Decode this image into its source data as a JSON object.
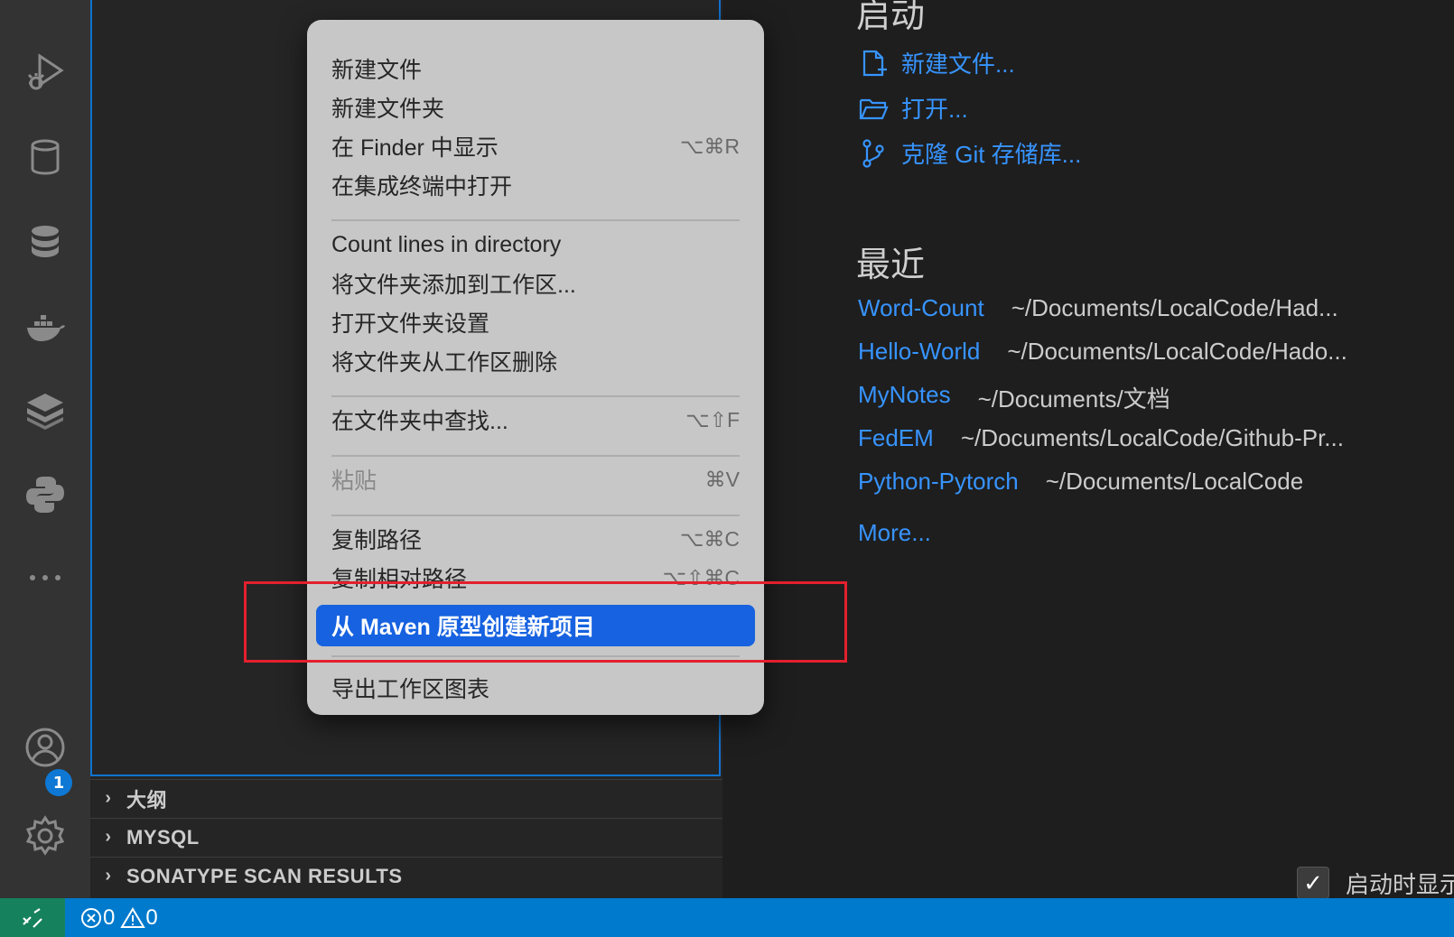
{
  "activity_bar": {
    "icons": [
      "run-debug-icon",
      "database-icon",
      "database-stack-icon",
      "docker-icon",
      "layers-icon",
      "python-icon",
      "more-icon",
      "account-icon",
      "settings-gear-icon"
    ],
    "account_badge": "1"
  },
  "sidebar": {
    "sections": [
      {
        "label": "大纲"
      },
      {
        "label": "MYSQL"
      },
      {
        "label": "SONATYPE SCAN RESULTS"
      }
    ]
  },
  "context_menu": {
    "items": [
      {
        "label": "新建文件",
        "shortcut": ""
      },
      {
        "label": "新建文件夹",
        "shortcut": ""
      },
      {
        "label": "在 Finder 中显示",
        "shortcut": "⌥⌘R"
      },
      {
        "label": "在集成终端中打开",
        "shortcut": ""
      },
      {
        "label": "Count lines in directory",
        "shortcut": ""
      },
      {
        "label": "将文件夹添加到工作区...",
        "shortcut": ""
      },
      {
        "label": "打开文件夹设置",
        "shortcut": ""
      },
      {
        "label": "将文件夹从工作区删除",
        "shortcut": ""
      },
      {
        "label": "在文件夹中查找...",
        "shortcut": "⌥⇧F"
      },
      {
        "label": "粘贴",
        "shortcut": "⌘V"
      },
      {
        "label": "复制路径",
        "shortcut": "⌥⌘C"
      },
      {
        "label": "复制相对路径",
        "shortcut": "⌥⇧⌘C"
      },
      {
        "label": "从 Maven 原型创建新项目",
        "shortcut": ""
      },
      {
        "label": "导出工作区图表",
        "shortcut": ""
      }
    ],
    "highlight_color": "#1662e0",
    "callout_color": "#e3202d"
  },
  "welcome": {
    "start_heading": "启动",
    "start_links": [
      {
        "label": "新建文件...",
        "icon": "new-file-icon"
      },
      {
        "label": "打开...",
        "icon": "folder-open-icon"
      },
      {
        "label": "克隆 Git 存储库...",
        "icon": "git-branch-icon"
      }
    ],
    "recent_heading": "最近",
    "recent": [
      {
        "name": "Word-Count",
        "path": "~/Documents/LocalCode/Had..."
      },
      {
        "name": "Hello-World",
        "path": "~/Documents/LocalCode/Hado..."
      },
      {
        "name": "MyNotes",
        "path": "~/Documents/文档"
      },
      {
        "name": "FedEM",
        "path": "~/Documents/LocalCode/Github-Pr..."
      },
      {
        "name": "Python-Pytorch",
        "path": "~/Documents/LocalCode"
      }
    ],
    "more": "More...",
    "startup_label": "启动时显示",
    "startup_checked": true
  },
  "status_bar": {
    "errors": "0",
    "warnings": "0",
    "accent": "#007acc",
    "remote_color": "#16825d"
  }
}
